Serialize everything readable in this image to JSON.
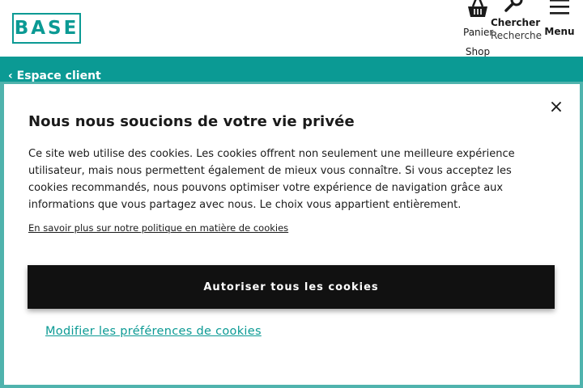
{
  "header": {
    "logo_text": "BASE",
    "basket": {
      "label": "Panier",
      "sublabel": "Shop"
    },
    "search": {
      "label": "Chercher",
      "sublabel": "Recherche"
    },
    "menu": {
      "label": "Menu"
    },
    "accent_color": "#0b9a94"
  },
  "subnav": {
    "back_link": "‹ Espace client"
  },
  "cookie_modal": {
    "title": "Nous nous soucions de votre vie privée",
    "close_icon": "×",
    "body": "Ce site web utilise des cookies. Les cookies offrent non seulement une meilleure expérience utilisateur, mais nous permettent également de mieux vous connaître. Si vous acceptez les cookies recommandés, nous pouvons optimiser votre expérience de navigation grâce aux informations que vous partagez avec nous. Le choix vous appartient entièrement.",
    "policy_link": "En savoir plus sur notre politique en matière de cookies",
    "accept_button": "Autoriser tous les cookies",
    "preferences_link": "Modifier les préférences de cookies"
  }
}
